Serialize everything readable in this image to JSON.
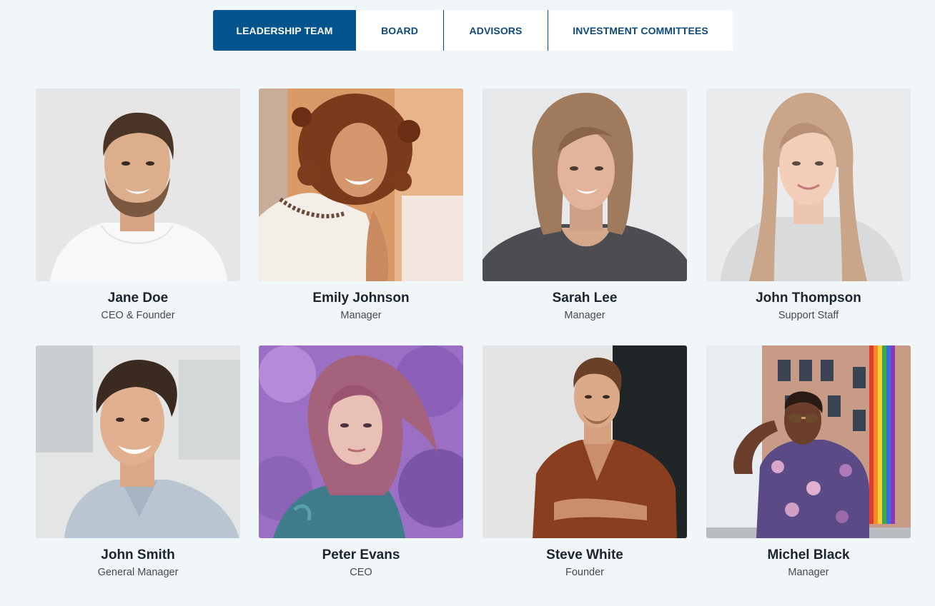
{
  "tabs": [
    {
      "label": "LEADERSHIP TEAM",
      "active": true
    },
    {
      "label": "BOARD",
      "active": false
    },
    {
      "label": "ADVISORS",
      "active": false
    },
    {
      "label": "INVESTMENT COMMITTEES",
      "active": false
    }
  ],
  "colors": {
    "page_background": "#f1f6f9",
    "active_tab": "#04548e",
    "tab_text": "#0e4a7a",
    "name_text": "#1d2430",
    "role_text": "#444a52"
  },
  "members": [
    {
      "name": "Jane Doe",
      "role": "CEO & Founder",
      "photo": "man-beard-white-tee-portrait"
    },
    {
      "name": "Emily Johnson",
      "role": "Manager",
      "photo": "woman-curly-hair-portrait"
    },
    {
      "name": "Sarah Lee",
      "role": "Manager",
      "photo": "woman-bob-hair-portrait"
    },
    {
      "name": "John Thompson",
      "role": "Support Staff",
      "photo": "woman-long-blonde-hair-portrait"
    },
    {
      "name": "John Smith",
      "role": "General Manager",
      "photo": "man-smiling-shirt-portrait"
    },
    {
      "name": "Peter Evans",
      "role": "CEO",
      "photo": "woman-purple-background-portrait"
    },
    {
      "name": "Steve White",
      "role": "Founder",
      "photo": "man-brown-shirt-portrait"
    },
    {
      "name": "Michel Black",
      "role": "Manager",
      "photo": "man-sunglasses-floral-shirt-portrait"
    }
  ]
}
